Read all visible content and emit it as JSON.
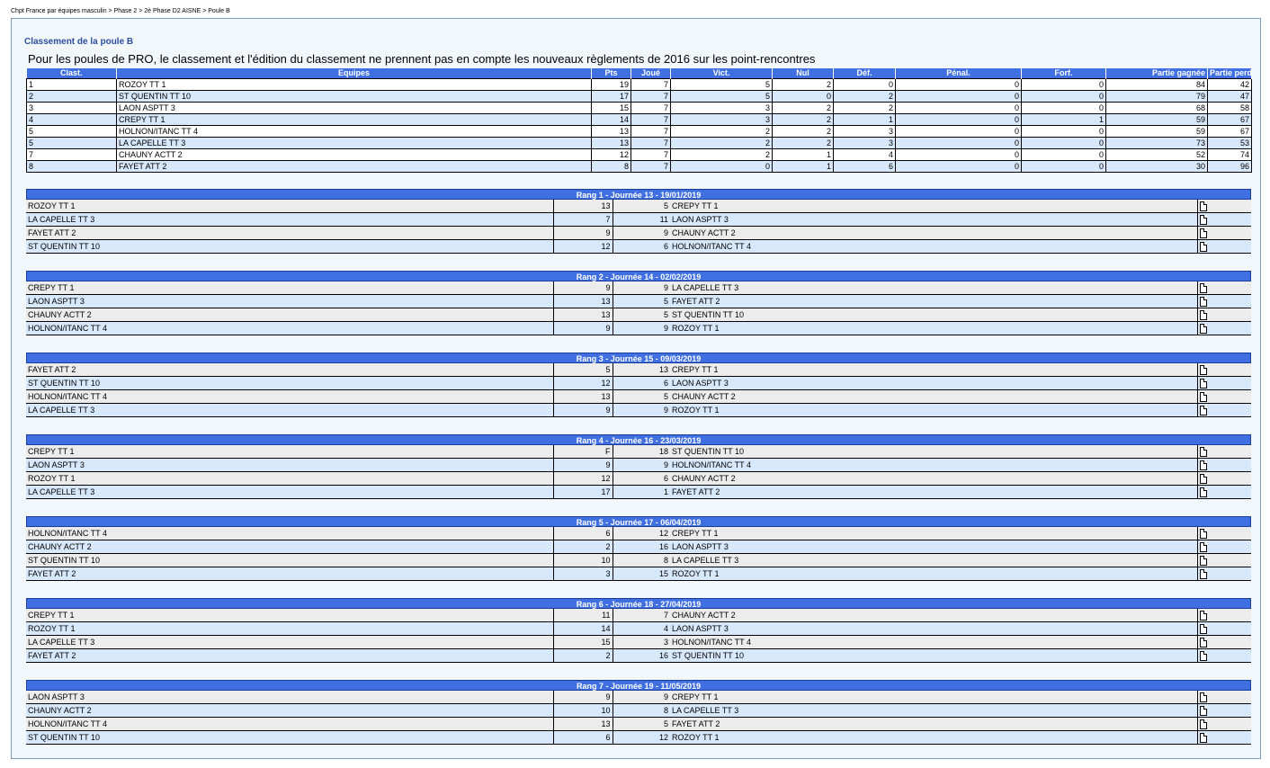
{
  "breadcrumb": "Chpt France par équipes masculin > Phase 2 > 2è Phase D2 AISNE > Poule B",
  "poule_title": "Classement de la poule B",
  "notice": "Pour les poules de PRO, le classement et l'édition du classement ne prennent pas en compte les nouveaux règlements de 2016 sur les point-rencontres",
  "standings": {
    "columns": [
      "Clast.",
      "Equipes",
      "Pts",
      "Joué",
      "Vict.",
      "Nul",
      "Déf.",
      "Pénal.",
      "Forf.",
      "Partie gagnée",
      "Partie perdue"
    ],
    "rows": [
      [
        "1",
        "ROZOY TT 1",
        "19",
        "7",
        "5",
        "2",
        "0",
        "0",
        "0",
        "84",
        "42"
      ],
      [
        "2",
        "ST QUENTIN TT 10",
        "17",
        "7",
        "5",
        "0",
        "2",
        "0",
        "0",
        "79",
        "47"
      ],
      [
        "3",
        "LAON ASPTT 3",
        "15",
        "7",
        "3",
        "2",
        "2",
        "0",
        "0",
        "68",
        "58"
      ],
      [
        "4",
        "CREPY TT 1",
        "14",
        "7",
        "3",
        "2",
        "1",
        "0",
        "1",
        "59",
        "67"
      ],
      [
        "5",
        "HOLNON/ITANC TT 4",
        "13",
        "7",
        "2",
        "2",
        "3",
        "0",
        "0",
        "59",
        "67"
      ],
      [
        "5",
        "LA CAPELLE TT 3",
        "13",
        "7",
        "2",
        "2",
        "3",
        "0",
        "0",
        "73",
        "53"
      ],
      [
        "7",
        "CHAUNY ACTT 2",
        "12",
        "7",
        "2",
        "1",
        "4",
        "0",
        "0",
        "52",
        "74"
      ],
      [
        "8",
        "FAYET ATT 2",
        "8",
        "7",
        "0",
        "1",
        "6",
        "0",
        "0",
        "30",
        "96"
      ]
    ]
  },
  "rounds": [
    {
      "title": "Rang 1 - Journée 13 - 19/01/2019",
      "matches": [
        [
          "ROZOY TT 1",
          "13",
          "5",
          "CREPY TT 1"
        ],
        [
          "LA CAPELLE TT 3",
          "7",
          "11",
          "LAON ASPTT 3"
        ],
        [
          "FAYET ATT 2",
          "9",
          "9",
          "CHAUNY ACTT 2"
        ],
        [
          "ST QUENTIN TT 10",
          "12",
          "6",
          "HOLNON/ITANC TT 4"
        ]
      ]
    },
    {
      "title": "Rang 2 - Journée 14 - 02/02/2019",
      "matches": [
        [
          "CREPY TT 1",
          "9",
          "9",
          "LA CAPELLE TT 3"
        ],
        [
          "LAON ASPTT 3",
          "13",
          "5",
          "FAYET ATT 2"
        ],
        [
          "CHAUNY ACTT 2",
          "13",
          "5",
          "ST QUENTIN TT 10"
        ],
        [
          "HOLNON/ITANC TT 4",
          "9",
          "9",
          "ROZOY TT 1"
        ]
      ]
    },
    {
      "title": "Rang 3 - Journée 15 - 09/03/2019",
      "matches": [
        [
          "FAYET ATT 2",
          "5",
          "13",
          "CREPY TT 1"
        ],
        [
          "ST QUENTIN TT 10",
          "12",
          "6",
          "LAON ASPTT 3"
        ],
        [
          "HOLNON/ITANC TT 4",
          "13",
          "5",
          "CHAUNY ACTT 2"
        ],
        [
          "LA CAPELLE TT 3",
          "9",
          "9",
          "ROZOY TT 1"
        ]
      ]
    },
    {
      "title": "Rang 4 - Journée 16 - 23/03/2019",
      "matches": [
        [
          "CREPY TT 1",
          "F",
          "18",
          "ST QUENTIN TT 10"
        ],
        [
          "LAON ASPTT 3",
          "9",
          "9",
          "HOLNON/ITANC TT 4"
        ],
        [
          "ROZOY TT 1",
          "12",
          "6",
          "CHAUNY ACTT 2"
        ],
        [
          "LA CAPELLE TT 3",
          "17",
          "1",
          "FAYET ATT 2"
        ]
      ]
    },
    {
      "title": "Rang 5 - Journée 17 - 06/04/2019",
      "matches": [
        [
          "HOLNON/ITANC TT 4",
          "6",
          "12",
          "CREPY TT 1"
        ],
        [
          "CHAUNY ACTT 2",
          "2",
          "16",
          "LAON ASPTT 3"
        ],
        [
          "ST QUENTIN TT 10",
          "10",
          "8",
          "LA CAPELLE TT 3"
        ],
        [
          "FAYET ATT 2",
          "3",
          "15",
          "ROZOY TT 1"
        ]
      ]
    },
    {
      "title": "Rang 6 - Journée 18 - 27/04/2019",
      "matches": [
        [
          "CREPY TT 1",
          "11",
          "7",
          "CHAUNY ACTT 2"
        ],
        [
          "ROZOY TT 1",
          "14",
          "4",
          "LAON ASPTT 3"
        ],
        [
          "LA CAPELLE TT 3",
          "15",
          "3",
          "HOLNON/ITANC TT 4"
        ],
        [
          "FAYET ATT 2",
          "2",
          "16",
          "ST QUENTIN TT 10"
        ]
      ]
    },
    {
      "title": "Rang 7 - Journée 19 - 11/05/2019",
      "matches": [
        [
          "LAON ASPTT 3",
          "9",
          "9",
          "CREPY TT 1"
        ],
        [
          "CHAUNY ACTT 2",
          "10",
          "8",
          "LA CAPELLE TT 3"
        ],
        [
          "HOLNON/ITANC TT 4",
          "13",
          "5",
          "FAYET ATT 2"
        ],
        [
          "ST QUENTIN TT 10",
          "6",
          "12",
          "ROZOY TT 1"
        ]
      ]
    }
  ],
  "icons": {
    "match_sheet": "document-icon"
  }
}
